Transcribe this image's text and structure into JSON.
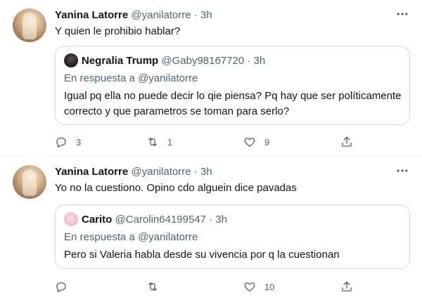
{
  "tweets": [
    {
      "author_name": "Yanina Latorre",
      "author_handle": "@yanilatorre",
      "separator": "·",
      "time": "3h",
      "text": "Y quien le prohibio hablar?",
      "quote": {
        "author_name": "Negralia Trump",
        "author_handle": "@Gaby98167720",
        "separator": "·",
        "time": "3h",
        "reply_prefix": "En respuesta a",
        "reply_to": "@yanilatorre",
        "text": "Igual pq ella no puede decir lo qie piensa? Pq hay que ser políticamente correcto y que parametros  se toman para serlo?"
      },
      "actions": {
        "replies": "3",
        "retweets": "1",
        "likes": "9"
      }
    },
    {
      "author_name": "Yanina Latorre",
      "author_handle": "@yanilatorre",
      "separator": "·",
      "time": "3h",
      "text": "Yo no la cuestiono. Opino cdo alguein dice pavadas",
      "quote": {
        "author_name": "Carito",
        "author_handle": "@Carolin64199547",
        "separator": "·",
        "time": "3h",
        "reply_prefix": "En respuesta a",
        "reply_to": "@yanilatorre",
        "text": "Pero si Valeria habla desde su vivencia por q la cuestionan"
      },
      "actions": {
        "replies": "",
        "retweets": "",
        "likes": "10"
      }
    }
  ],
  "icons": {
    "reply": "reply-icon",
    "retweet": "retweet-icon",
    "like": "heart-icon",
    "share": "share-icon",
    "more": "more-icon"
  },
  "colors": {
    "text_primary": "#0f1419",
    "text_secondary": "#536471",
    "border": "#cfd9de"
  }
}
